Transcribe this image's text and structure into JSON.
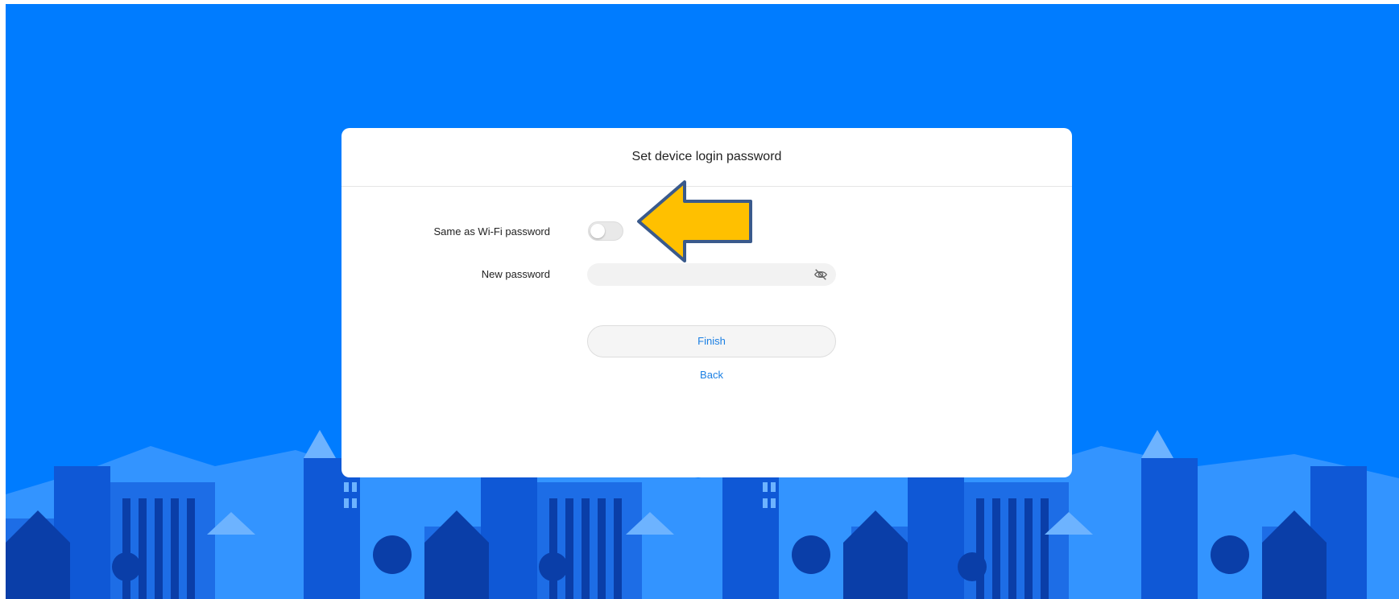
{
  "dialog": {
    "title": "Set device login password",
    "same_as_wifi_label": "Same as Wi-Fi password",
    "same_as_wifi_enabled": false,
    "new_password_label": "New password",
    "new_password_value": "",
    "finish_label": "Finish",
    "back_label": "Back"
  },
  "icons": {
    "password_visibility": "eye-slash-icon",
    "annotation": "arrow-left-icon"
  },
  "colors": {
    "background": "#007cff",
    "accent": "#1a7fe3",
    "annotation_arrow": "#ffc000",
    "annotation_outline": "#3a5a8c"
  }
}
